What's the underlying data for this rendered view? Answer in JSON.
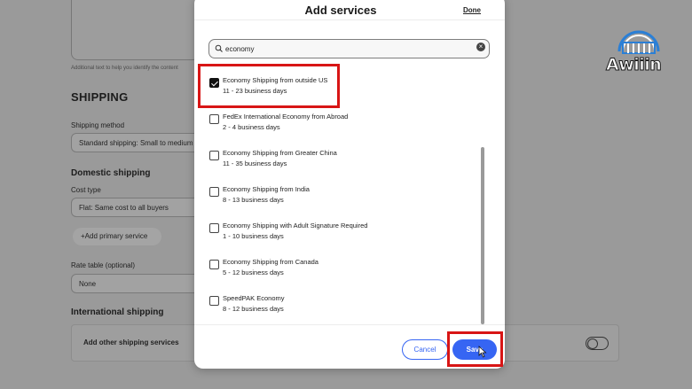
{
  "background": {
    "hint_text": "Additional text to help you identify the content",
    "shipping_heading": "SHIPPING",
    "shipping_method_label": "Shipping method",
    "shipping_method_value": "Standard shipping: Small to medium",
    "domestic_heading": "Domestic shipping",
    "cost_type_label": "Cost type",
    "cost_type_value": "Flat: Same cost to all buyers",
    "add_primary_service": "Add primary service",
    "rate_table_label": "Rate table (optional)",
    "rate_table_value": "None",
    "international_heading": "International shipping",
    "add_other_services": "Add other shipping services"
  },
  "logo": {
    "text": "Awiiin",
    "icon": "building-logo-icon"
  },
  "modal": {
    "title": "Add services",
    "done_label": "Done",
    "search": {
      "value": "economy",
      "icon": "search-icon"
    },
    "items": [
      {
        "name": "Economy Shipping from outside US",
        "days": "11 - 23 business days",
        "checked": true
      },
      {
        "name": "FedEx International Economy from Abroad",
        "days": "2 - 4 business days",
        "checked": false
      },
      {
        "name": "Economy Shipping from Greater China",
        "days": "11 - 35 business days",
        "checked": false
      },
      {
        "name": "Economy Shipping from India",
        "days": "8 - 13 business days",
        "checked": false
      },
      {
        "name": "Economy Shipping with Adult Signature Required",
        "days": "1 - 10 business days",
        "checked": false
      },
      {
        "name": "Economy Shipping from Canada",
        "days": "5 - 12 business days",
        "checked": false
      },
      {
        "name": "SpeedPAK Economy",
        "days": "8 - 12 business days",
        "checked": false
      }
    ],
    "cancel_label": "Cancel",
    "save_label": "Save"
  },
  "colors": {
    "accent": "#3665f3",
    "highlight": "#d81515"
  }
}
